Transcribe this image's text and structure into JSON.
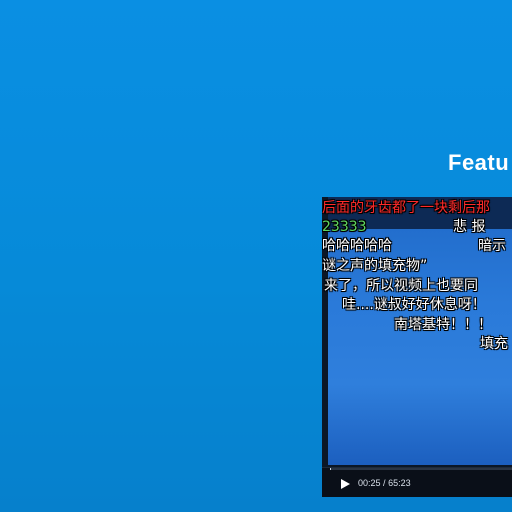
{
  "section": {
    "heading": "Featu"
  },
  "player": {
    "danmaku": [
      "后面的牙齿都了一块剩后那",
      "23333",
      "悲 报",
      "哈哈哈哈哈",
      "暗示",
      "谜之声的填充物”",
      "来了，所以视频上也要同",
      "哇....谜叔好好休息呀！",
      "南塔基特！！！",
      "填充"
    ],
    "controls": {
      "play_icon": "play-icon",
      "current_time": "00:25",
      "separator": "/",
      "duration": "65:23",
      "progress": 0.0064
    }
  },
  "colors": {
    "background": "#0a8fe3",
    "danmaku_red": "#ff2a2a",
    "danmaku_green": "#5fd65f",
    "danmaku_white": "#ffffff"
  }
}
